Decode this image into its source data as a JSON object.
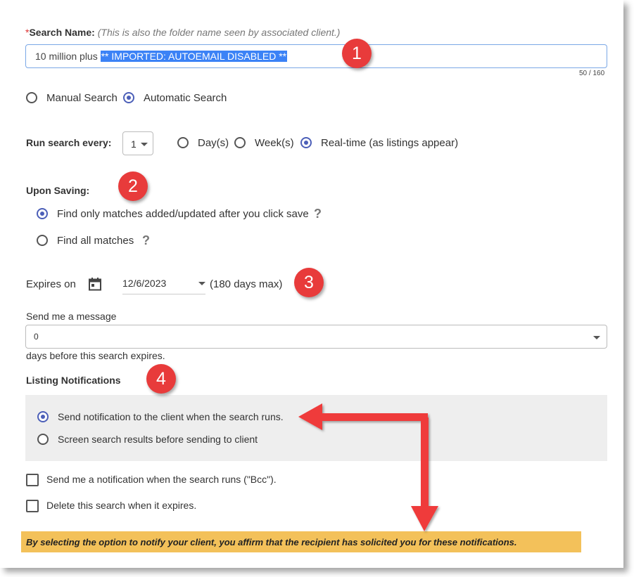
{
  "search_name": {
    "required_mark": "*",
    "label": "Search Name:",
    "hint": "(This is also the folder name seen by associated client.)",
    "value_plain": "10 million plus",
    "value_selected": "** IMPORTED: AUTOEMAIL DISABLED **",
    "counter": "50 / 160"
  },
  "search_type": {
    "options": [
      {
        "label": "Manual Search",
        "selected": false
      },
      {
        "label": "Automatic Search",
        "selected": true
      }
    ]
  },
  "run_every": {
    "label": "Run search every:",
    "value": "1",
    "options": [
      {
        "label": "Day(s)",
        "selected": false
      },
      {
        "label": "Week(s)",
        "selected": false
      },
      {
        "label": "Real-time (as listings appear)",
        "selected": true
      }
    ]
  },
  "upon_saving": {
    "label": "Upon Saving:",
    "options": [
      {
        "label": "Find only matches added/updated after you click save",
        "selected": true,
        "help": "?"
      },
      {
        "label": "Find all matches",
        "selected": false,
        "help": "?"
      }
    ]
  },
  "expires": {
    "label": "Expires on",
    "date": "12/6/2023",
    "max_note": "(180 days max)"
  },
  "message": {
    "label": "Send me a message",
    "value": "0",
    "suffix": "days before this search expires."
  },
  "listing_notifications": {
    "label": "Listing Notifications",
    "options": [
      {
        "label": "Send notification to the client when the search runs.",
        "selected": true
      },
      {
        "label": "Screen search results before sending to client",
        "selected": false
      }
    ]
  },
  "checkboxes": [
    {
      "label": "Send me a notification when the search runs (\"Bcc\").",
      "checked": false
    },
    {
      "label": "Delete this search when it expires.",
      "checked": false
    }
  ],
  "disclaimer": "By selecting the option to notify your client, you affirm that the recipient has solicited you for these notifications.",
  "badges": [
    "1",
    "2",
    "3",
    "4"
  ],
  "colors": {
    "accent": "#4c5fb8",
    "selection": "#3b82f6",
    "badge": "#e83b3b",
    "arrow": "#ef3b3b",
    "disclaimer_bg": "#f3c15a",
    "panel_bg": "#eeeeee"
  }
}
